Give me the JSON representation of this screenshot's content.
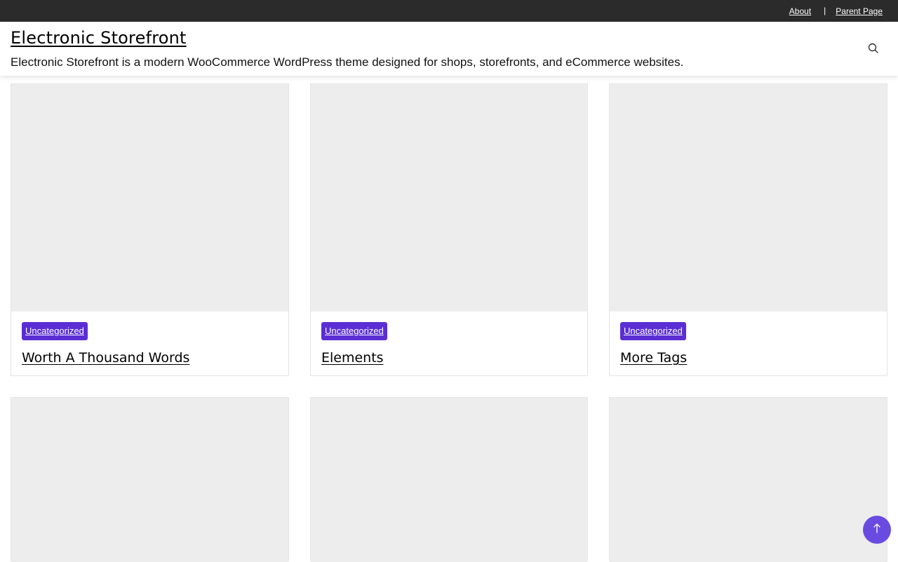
{
  "topbar": {
    "links": [
      {
        "label": "About"
      },
      {
        "label": "Parent Page"
      }
    ],
    "separator": "|"
  },
  "header": {
    "site_title": "Electronic Storefront",
    "tagline": "Electronic Storefront is a modern WooCommerce WordPress theme designed for shops, storefronts, and eCommerce websites.",
    "search_icon": "search-icon"
  },
  "posts": [
    {
      "category": "Uncategorized",
      "title": "Worth A Thousand Words"
    },
    {
      "category": "Uncategorized",
      "title": "Elements"
    },
    {
      "category": "Uncategorized",
      "title": "More Tags"
    }
  ],
  "scroll_top_icon": "arrow-up-icon",
  "colors": {
    "topbar_bg": "#2b2b2b",
    "accent": "#5b2ed4",
    "scroll_button": "#6a4be0",
    "thumb_placeholder": "#ededed"
  }
}
